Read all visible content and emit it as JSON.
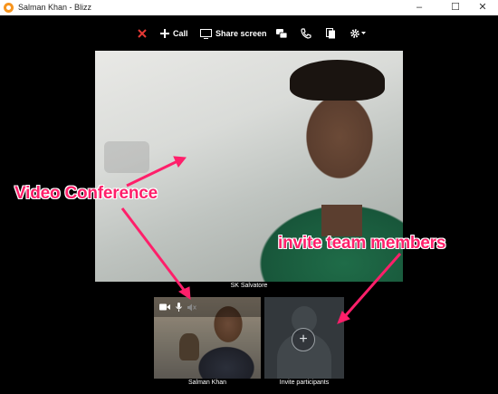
{
  "window": {
    "title": "Salman Khan - Blizz",
    "minimize_icon": "minimize-icon",
    "maximize_icon": "maximize-icon",
    "close_icon": "close-icon"
  },
  "toolbar": {
    "end_call_icon": "close-x-icon",
    "call_label": "Call",
    "share_screen_label": "Share screen",
    "chat_icon": "chat-icon",
    "phone_icon": "phone-icon",
    "files_icon": "files-icon",
    "settings_icon": "gear-icon"
  },
  "main_video": {
    "participant_name": "SK Salvatore"
  },
  "thumbnails": [
    {
      "name": "Salman Khan",
      "controls": [
        "video-icon",
        "microphone-icon",
        "volume-icon"
      ]
    },
    {
      "name": "Invite participants",
      "icon": "add-participant-icon"
    }
  ],
  "annotations": {
    "video_conference": "Video Conference",
    "invite_team": "invite team members",
    "color": "#ff1f6a"
  },
  "colors": {
    "accent_brand": "#f7941d",
    "end_call_red": "#e53935"
  }
}
